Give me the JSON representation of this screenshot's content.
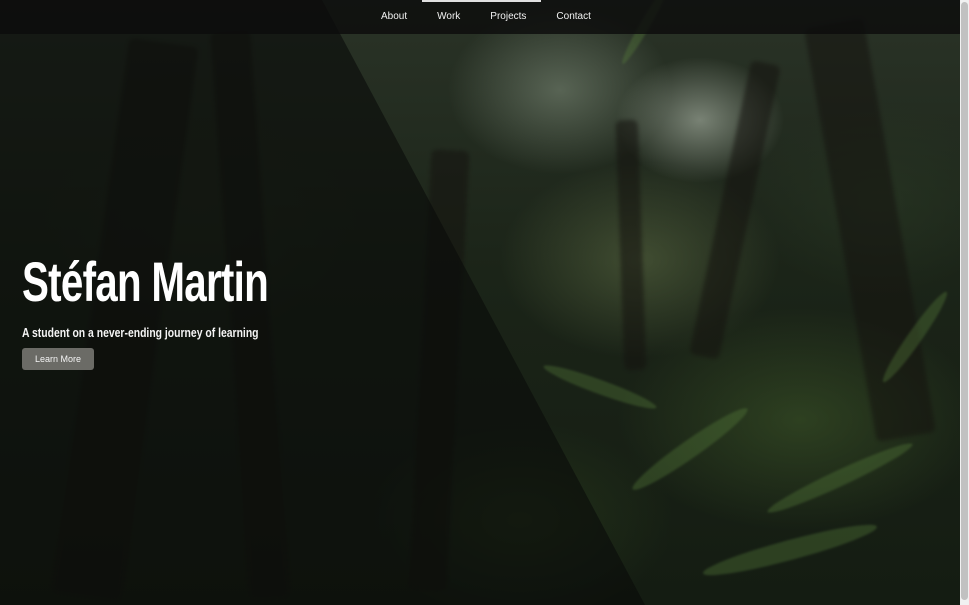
{
  "nav": {
    "items": [
      {
        "label": "About"
      },
      {
        "label": "Work"
      },
      {
        "label": "Projects"
      },
      {
        "label": "Contact"
      }
    ]
  },
  "hero": {
    "title": "Stéfan Martin",
    "subtitle": "A student on a never-ending journey of learning",
    "button_label": "Learn More"
  },
  "colors": {
    "navbar_bg": "#0c0c0c",
    "overlay": "#0a0c0a",
    "button_bg": "#6b6b66",
    "text": "#ffffff"
  }
}
